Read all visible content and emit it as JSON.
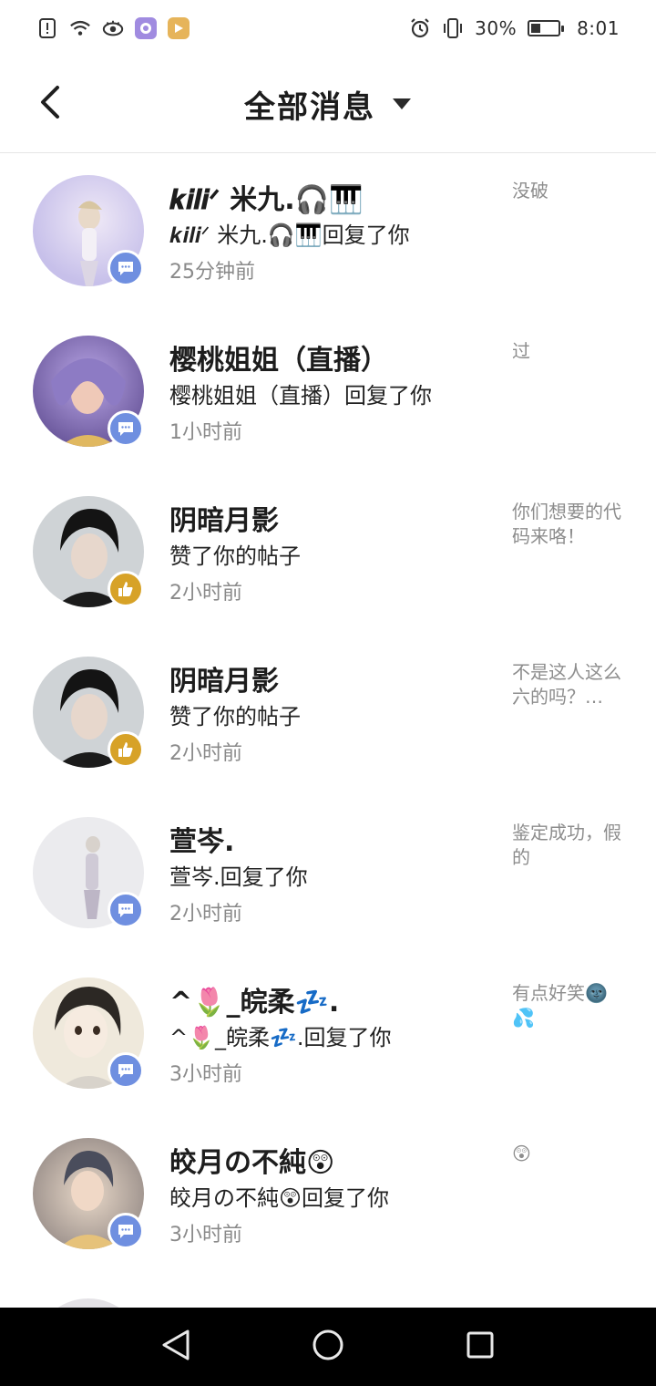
{
  "status_bar": {
    "battery": "30%",
    "battery_level": 0.3,
    "time": "8:01",
    "icons_left": [
      "alert-icon",
      "wifi-icon",
      "eye-icon",
      "app-notification-icon",
      "app-notification-icon"
    ],
    "icons_right": [
      "alarm-icon",
      "vibrate-icon",
      "battery-icon"
    ]
  },
  "header": {
    "title": "全部消息",
    "back_icon": "chevron-left-icon",
    "dropdown_icon": "caret-down-icon"
  },
  "messages": [
    {
      "name": "𝒌𝒊𝒍𝒊ᐟ 米九.🎧🎹",
      "desc": "𝒌𝒊𝒍𝒊ᐟ 米九.🎧🎹回复了你",
      "time": "25分钟前",
      "snippet": "没破",
      "badge": "reply",
      "avatar_color": "#c7c0ea"
    },
    {
      "name": "樱桃姐姐（直播）",
      "desc": "樱桃姐姐（直播）回复了你",
      "time": "1小时前",
      "snippet": "过",
      "badge": "reply",
      "avatar_color": "#8d7bc4"
    },
    {
      "name": "阴暗月影",
      "desc": "赞了你的帖子",
      "time": "2小时前",
      "snippet": "你们想要的代码来咯！",
      "badge": "like",
      "avatar_color": "#3a3f45"
    },
    {
      "name": "阴暗月影",
      "desc": "赞了你的帖子",
      "time": "2小时前",
      "snippet": "不是这人这么六的吗？…",
      "badge": "like",
      "avatar_color": "#3a3f45"
    },
    {
      "name": "萱岑.",
      "desc": "萱岑.回复了你",
      "time": "2小时前",
      "snippet": "鉴定成功，假的",
      "badge": "reply",
      "avatar_color": "#e6e6ea"
    },
    {
      "name": "^🌷_皖柔💤.",
      "desc": "^🌷_皖柔💤.回复了你",
      "time": "3小时前",
      "snippet": "有点好笑🌚💦",
      "badge": "reply",
      "avatar_color": "#d9d3c6"
    },
    {
      "name": "皎月の不純😲",
      "desc": "皎月の不純😲回复了你",
      "time": "3小时前",
      "snippet": "😲",
      "badge": "reply",
      "avatar_color": "#b9aaa0"
    }
  ]
}
